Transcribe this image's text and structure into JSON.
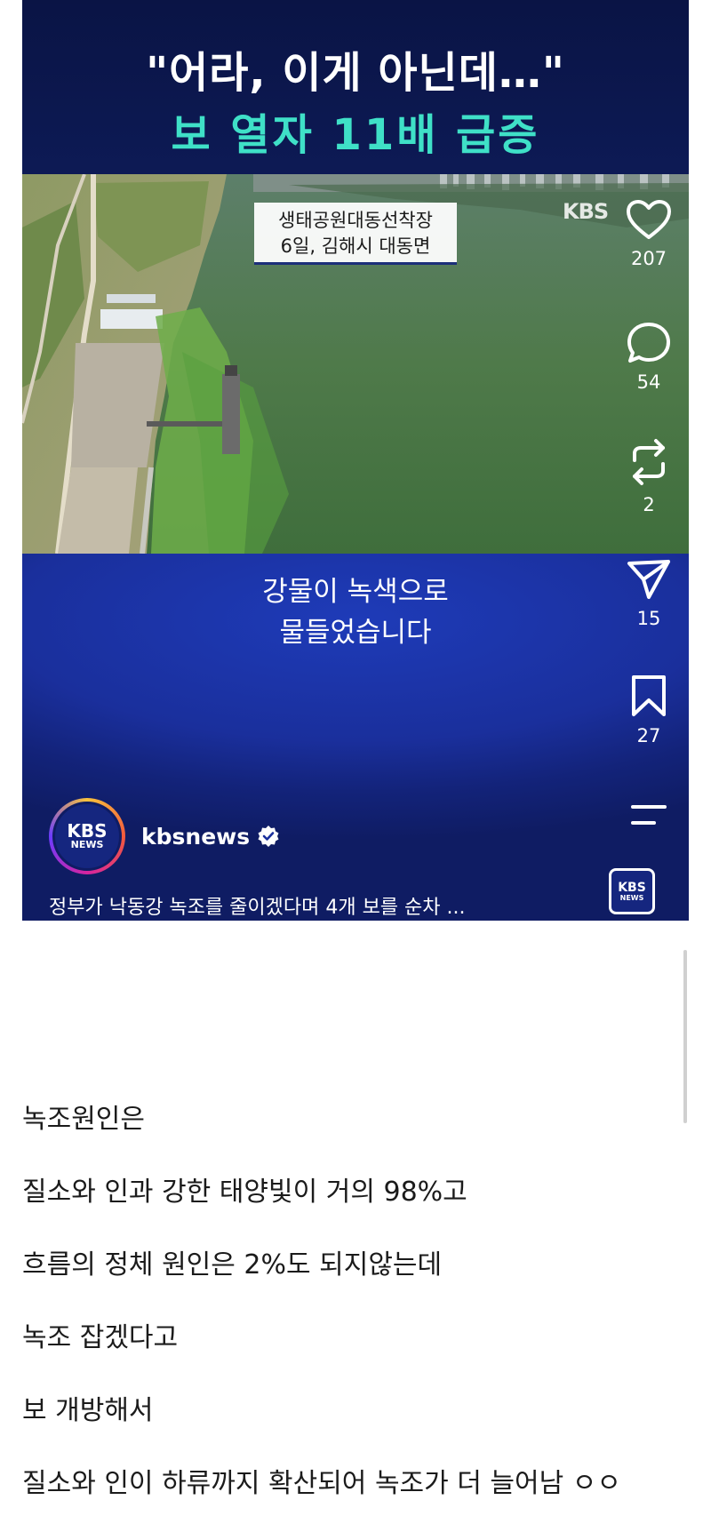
{
  "video": {
    "headline_line1": "\"어라, 이게 아닌데…\"",
    "headline_line2": "보 열자 11배 급증",
    "location_line1": "생태공원대동선착장",
    "location_line2": "6일, 김해시 대동면",
    "watermark": "KBS",
    "subtitle_line1": "강물이 녹색으로",
    "subtitle_line2": "물들었습니다",
    "account_name": "kbsnews",
    "avatar_big": "KBS",
    "avatar_small": "NEWS",
    "caption": "정부가 낙동강 녹조를 줄이겠다며 4개 보를 순차 ...",
    "colors": {
      "headline_accent": "#3fe0c7",
      "background_blue": "#1a2f9c",
      "river_green": "#4f7a4a"
    }
  },
  "actions": [
    {
      "icon": "heart-icon",
      "count": "207"
    },
    {
      "icon": "comment-icon",
      "count": "54"
    },
    {
      "icon": "repost-icon",
      "count": "2"
    },
    {
      "icon": "send-icon",
      "count": "15"
    },
    {
      "icon": "bookmark-icon",
      "count": "27"
    },
    {
      "icon": "menu-icon",
      "count": ""
    }
  ],
  "chip": {
    "big": "KBS",
    "small": "NEWS"
  },
  "post": {
    "lines": [
      "녹조원인은",
      "질소와 인과 강한 태양빛이 거의 98%고",
      "흐름의 정체 원인은 2%도 되지않는데",
      "녹조 잡겠다고",
      "보 개방해서",
      "질소와 인이 하류까지 확산되어 녹조가 더 늘어남 ㅇㅇ"
    ]
  }
}
